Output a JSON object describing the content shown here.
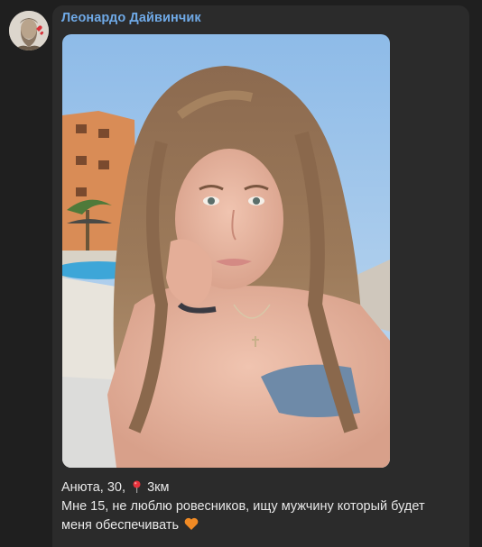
{
  "message": {
    "sender_name": "Леонардо Дайвинчик",
    "avatar_icon": "leonardo-portrait-avatar",
    "photo_icon": "profile-photo",
    "caption": {
      "name_age": "Анюта, 30,",
      "location_icon": "round-pushpin-icon",
      "distance": "3км",
      "bio_line1": "Мне 15, не люблю ровесников, ищу мужчину который будет",
      "bio_line2": "меня обеспечивать",
      "end_icon": "orange-heart-icon"
    }
  },
  "colors": {
    "background": "#1f1f1f",
    "bubble": "#2b2b2b",
    "sender_name": "#6fa9e6",
    "caption_text": "#e8e8e8",
    "pin": "#e8323c",
    "heart": "#f08a24"
  }
}
